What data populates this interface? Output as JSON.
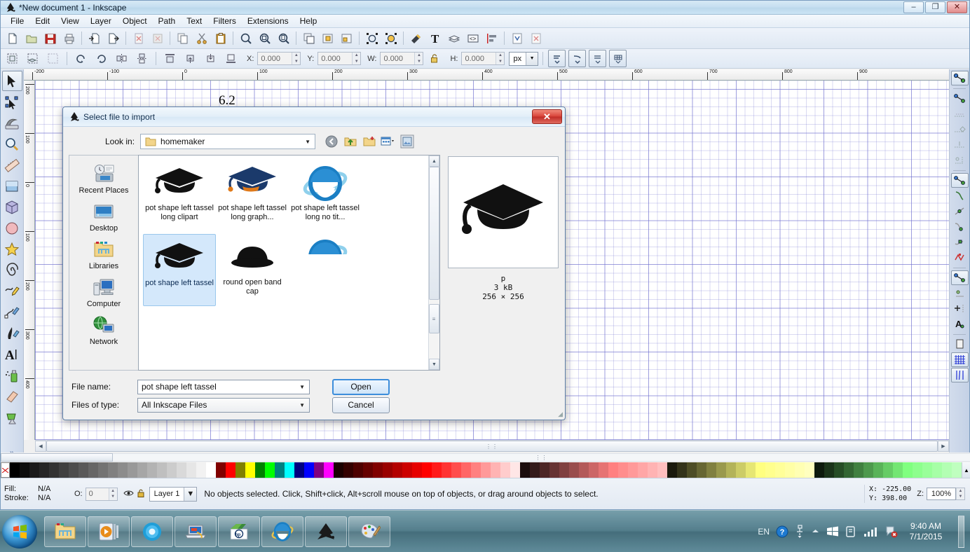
{
  "window": {
    "title": "*New document 1 - Inkscape",
    "minimize": "–",
    "maximize": "❐",
    "close": "✕"
  },
  "menubar": {
    "items": [
      "File",
      "Edit",
      "View",
      "Layer",
      "Object",
      "Path",
      "Text",
      "Filters",
      "Extensions",
      "Help"
    ]
  },
  "toolbar_commands": {
    "icons": [
      "new-document-icon",
      "open-document-icon",
      "save-document-icon",
      "print-icon",
      "import-icon",
      "export-icon",
      "undo-icon",
      "redo-icon",
      "copy-icon",
      "cut-icon",
      "paste-icon",
      "zoom-selection-icon",
      "zoom-drawing-icon",
      "zoom-page-icon",
      "duplicate-icon",
      "group-icon",
      "ungroup-icon",
      "fill-stroke-dialog-icon",
      "fill-stroke-selector-icon",
      "fill-stroke-editor-icon",
      "text-tool-icon",
      "layers-icon",
      "xml-editor-icon",
      "align-distribute-icon",
      "preferences-icon",
      "document-properties-icon"
    ]
  },
  "tool_options": {
    "x_label": "X:",
    "x_value": "0.000",
    "y_label": "Y:",
    "y_value": "0.000",
    "w_label": "W:",
    "w_value": "0.000",
    "lock_icon": "lock-open-icon",
    "h_label": "H:",
    "h_value": "0.000",
    "units": "px"
  },
  "toolbox": {
    "tools": [
      {
        "name": "selector-tool",
        "icon": "arrow-cursor-icon",
        "active": true
      },
      {
        "name": "node-tool",
        "icon": "node-editor-icon",
        "active": false
      },
      {
        "name": "tweak-tool",
        "icon": "tweak-icon",
        "active": false
      },
      {
        "name": "zoom-tool",
        "icon": "magnifier-icon",
        "active": false
      },
      {
        "name": "measure-tool",
        "icon": "ruler-icon",
        "active": false
      },
      {
        "name": "rectangle-tool",
        "icon": "rectangle-icon",
        "active": false
      },
      {
        "name": "box3d-tool",
        "icon": "cube-icon",
        "active": false
      },
      {
        "name": "ellipse-tool",
        "icon": "circle-icon",
        "active": false
      },
      {
        "name": "star-tool",
        "icon": "star-icon",
        "active": false
      },
      {
        "name": "spiral-tool",
        "icon": "spiral-icon",
        "active": false
      },
      {
        "name": "pencil-tool",
        "icon": "pencil-icon",
        "active": false
      },
      {
        "name": "bezier-tool",
        "icon": "pen-icon",
        "active": false
      },
      {
        "name": "calligraphy-tool",
        "icon": "calligraphy-icon",
        "active": false
      },
      {
        "name": "text-tool",
        "icon": "letter-a-icon",
        "active": false
      },
      {
        "name": "spray-tool",
        "icon": "spray-can-icon",
        "active": false
      },
      {
        "name": "eraser-tool",
        "icon": "eraser-icon",
        "active": false
      },
      {
        "name": "paint-bucket-tool",
        "icon": "paint-bucket-icon",
        "active": false
      }
    ],
    "more": "»"
  },
  "rulers": {
    "horizontal_labels": [
      "-200",
      "-100",
      "0",
      "100",
      "200",
      "300",
      "400",
      "500",
      "600",
      "700",
      "800",
      "900"
    ],
    "vertical_labels": [
      "200",
      "100",
      "0",
      "100",
      "200",
      "300",
      "400"
    ]
  },
  "canvas": {
    "text": "6.2"
  },
  "snapbar": {
    "icons": [
      "enable-snapping-icon",
      "snap-bounding-box-icon",
      "snap-bbox-edge-icon",
      "snap-bbox-corner-icon",
      "snap-bbox-edge-midpoint-icon",
      "snap-bbox-center-icon",
      "snap-nodes-icon",
      "snap-path-icon",
      "snap-path-intersection-icon",
      "snap-cusp-node-icon",
      "snap-smooth-node-icon",
      "snap-line-midpoint-icon",
      "snap-others-icon",
      "snap-object-center-icon",
      "snap-rotation-center-icon",
      "snap-text-baseline-icon",
      "snap-page-border-icon",
      "snap-grid-icon",
      "snap-guide-icon"
    ]
  },
  "dialog": {
    "title": "Select file to import",
    "close_label": "✕",
    "lookin_label": "Look in:",
    "lookin_value": "homemaker",
    "nav_icons": [
      "back-icon",
      "up-folder-icon",
      "new-folder-icon",
      "view-menu-icon",
      "preview-pane-icon"
    ],
    "places": [
      {
        "name": "Recent Places",
        "icon": "recent-places-icon"
      },
      {
        "name": "Desktop",
        "icon": "desktop-icon"
      },
      {
        "name": "Libraries",
        "icon": "libraries-folder-icon"
      },
      {
        "name": "Computer",
        "icon": "computer-icon"
      },
      {
        "name": "Network",
        "icon": "network-icon"
      }
    ],
    "files": [
      {
        "name": "pot shape left tassel long clipart",
        "icon": "graduation-cap-icon",
        "selected": false
      },
      {
        "name": "pot shape left tassel long graph...",
        "icon": "graduation-cap-blue-icon",
        "selected": false
      },
      {
        "name": "pot shape left tassel long no tit...",
        "icon": "internet-explorer-icon",
        "selected": false
      },
      {
        "name": "pot shape left tassel",
        "icon": "graduation-cap-icon",
        "selected": true
      },
      {
        "name": "round open band cap",
        "icon": "round-cap-icon",
        "selected": false
      }
    ],
    "preview": {
      "image_icon": "graduation-cap-icon",
      "name": "p",
      "size": "3 kB",
      "dimensions": "256 × 256"
    },
    "filename_label": "File name:",
    "filename_value": "pot shape left tassel",
    "filetype_label": "Files of type:",
    "filetype_value": "All Inkscape Files",
    "open_button": "Open",
    "cancel_button": "Cancel"
  },
  "statusbar": {
    "fill_label": "Fill:",
    "fill_value": "N/A",
    "stroke_label": "Stroke:",
    "stroke_value": "N/A",
    "opacity_label": "O:",
    "opacity_value": "0",
    "eye_icon": "visibility-icon",
    "lock_icon": "layer-lock-icon",
    "layer_name": "Layer 1",
    "message": "No objects selected. Click, Shift+click, Alt+scroll mouse on top of objects, or drag around objects to select.",
    "x_label": "X:",
    "x_value": "-225.00",
    "y_label": "Y:",
    "y_value": "398.00",
    "zoom_label": "Z:",
    "zoom_value": "100%"
  },
  "palette": {
    "none_swatch": "no-color-icon",
    "colors": [
      "#000000",
      "#0d0d0d",
      "#1a1a1a",
      "#262626",
      "#333333",
      "#404040",
      "#4d4d4d",
      "#595959",
      "#666666",
      "#737373",
      "#808080",
      "#8c8c8c",
      "#999999",
      "#a6a6a6",
      "#b3b3b3",
      "#bfbfbf",
      "#cccccc",
      "#d9d9d9",
      "#e6e6e6",
      "#f2f2f2",
      "#ffffff",
      "#800000",
      "#ff0000",
      "#808000",
      "#ffff00",
      "#008000",
      "#00ff00",
      "#008080",
      "#00ffff",
      "#000080",
      "#0000ff",
      "#800080",
      "#ff00ff",
      "#1a0000",
      "#330000",
      "#4d0000",
      "#660000",
      "#800000",
      "#990000",
      "#b30000",
      "#cc0000",
      "#e60000",
      "#ff0000",
      "#ff1a1a",
      "#ff3333",
      "#ff4d4d",
      "#ff6666",
      "#ff8080",
      "#ff9999",
      "#ffb3b3",
      "#ffcccc",
      "#ffe6e6",
      "#1a0d0d",
      "#331a1a",
      "#4d2626",
      "#663333",
      "#804040",
      "#994d4d",
      "#b35959",
      "#cc6666",
      "#e67373",
      "#ff8080",
      "#ff8d8d",
      "#ff9999",
      "#ffa6a6",
      "#ffb3b3",
      "#ffbfbf",
      "#1a1a0d",
      "#33331a",
      "#4d4d26",
      "#666633",
      "#808040",
      "#99994d",
      "#b3b359",
      "#cccc66",
      "#e6e673",
      "#ffff80",
      "#ffff8d",
      "#ffff99",
      "#ffffa6",
      "#ffffb3",
      "#ffffbf",
      "#0d1a0d",
      "#1a331a",
      "#264d26",
      "#336633",
      "#408040",
      "#4d994d",
      "#59b359",
      "#66cc66",
      "#73e673",
      "#80ff80",
      "#8dff8d",
      "#99ff99",
      "#a6ffa6",
      "#b3ffb3",
      "#bfffbf"
    ],
    "scroll_arrow": "▲"
  },
  "taskbar": {
    "start": "windows-start-orb-icon",
    "apps": [
      {
        "name": "windows-explorer-icon"
      },
      {
        "name": "windows-media-player-icon"
      },
      {
        "name": "sphere-app-icon"
      },
      {
        "name": "laptop-support-icon"
      },
      {
        "name": "hp-app-icon"
      },
      {
        "name": "internet-explorer-icon"
      },
      {
        "name": "inkscape-icon"
      },
      {
        "name": "paint-palette-icon"
      }
    ],
    "tray": {
      "language": "EN",
      "help_icon": "help-blue-icon",
      "network_icon": "network-tray-icon",
      "show_hidden_icon": "show-hidden-icons-icon",
      "windows_icon": "windows-flag-tray-icon",
      "device_icon": "device-tray-icon",
      "signal_icon": "signal-bars-icon",
      "action_center_icon": "action-center-error-icon"
    },
    "clock": {
      "time": "9:40 AM",
      "date": "7/1/2015"
    }
  }
}
